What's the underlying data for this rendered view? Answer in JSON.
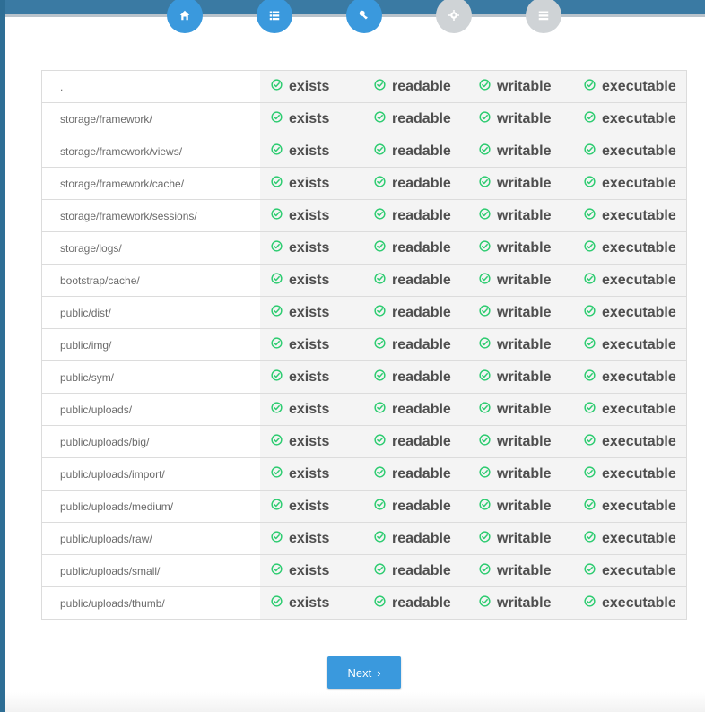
{
  "wizard": {
    "steps": [
      {
        "icon": "home-icon",
        "state": "active"
      },
      {
        "icon": "list-icon",
        "state": "active"
      },
      {
        "icon": "key-icon",
        "state": "active"
      },
      {
        "icon": "gear-icon",
        "state": "inactive"
      },
      {
        "icon": "database-icon",
        "state": "inactive"
      }
    ]
  },
  "permissions": {
    "status_labels": [
      "exists",
      "readable",
      "writable",
      "executable"
    ],
    "rows": [
      {
        "path": "."
      },
      {
        "path": "storage/framework/"
      },
      {
        "path": "storage/framework/views/"
      },
      {
        "path": "storage/framework/cache/"
      },
      {
        "path": "storage/framework/sessions/"
      },
      {
        "path": "storage/logs/"
      },
      {
        "path": "bootstrap/cache/"
      },
      {
        "path": "public/dist/"
      },
      {
        "path": "public/img/"
      },
      {
        "path": "public/sym/"
      },
      {
        "path": "public/uploads/"
      },
      {
        "path": "public/uploads/big/"
      },
      {
        "path": "public/uploads/import/"
      },
      {
        "path": "public/uploads/medium/"
      },
      {
        "path": "public/uploads/raw/"
      },
      {
        "path": "public/uploads/small/"
      },
      {
        "path": "public/uploads/thumb/"
      }
    ]
  },
  "actions": {
    "next_label": "Next",
    "next_icon": "chevron-right-icon"
  },
  "colors": {
    "accent": "#3a99dd",
    "success": "#2ecc71",
    "header": "#3a7aa3"
  }
}
